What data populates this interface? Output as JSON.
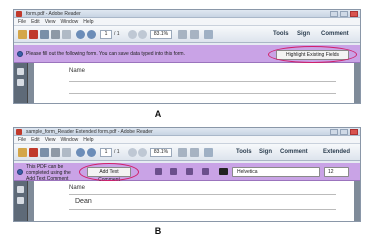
{
  "panel_a": {
    "title": "form.pdf - Adobe Reader",
    "menu": [
      "File",
      "Edit",
      "View",
      "Window",
      "Help"
    ],
    "page_current": "1",
    "page_total": "/ 1",
    "zoom": "83.1%",
    "tools_label": "Tools",
    "sign_label": "Sign",
    "comment_label": "Comment",
    "message": "Please fill out the following form. You can save data typed into this form.",
    "highlight_button": "Highlight Existing Fields",
    "field_name": "Name"
  },
  "panel_b": {
    "title": "sample_form_Reader Extended form.pdf - Adobe Reader",
    "menu": [
      "File",
      "Edit",
      "View",
      "Window",
      "Help"
    ],
    "page_current": "1",
    "page_total": "/ 1",
    "zoom": "83.1%",
    "tools_label": "Tools",
    "sign_label": "Sign",
    "comment_label": "Comment",
    "extended_label": "Extended",
    "message": "This PDF can be completed using the Add Text Comment tool.",
    "add_text_button": "Add Text Comment",
    "font_name": "Helvetica",
    "font_size": "12",
    "field_name": "Name",
    "field_value": "Dean"
  },
  "captions": {
    "a": "A",
    "b": "B"
  },
  "colors": {
    "message_bar": "#c9a3e6",
    "highlight_ellipse": "#d0206c"
  }
}
